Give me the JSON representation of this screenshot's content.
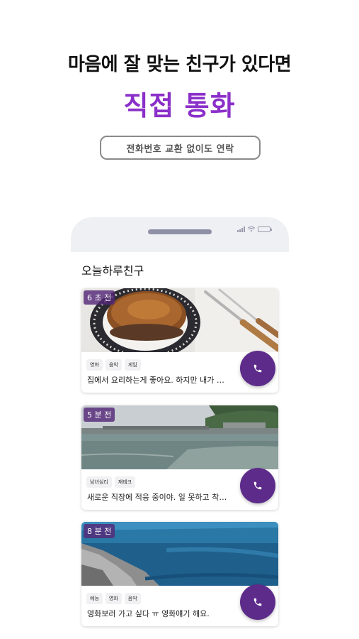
{
  "promo": {
    "headline": "마음에 잘 맞는 친구가 있다면",
    "title": "직접 통화",
    "pill": "전화번호 교환 없이도 연락",
    "accent_color": "#8b2fc9"
  },
  "phone": {
    "section_title": "오늘하루친구",
    "cards": [
      {
        "time": "6 초 전",
        "tags": [
          "영화",
          "음악",
          "게임"
        ],
        "message": "집에서 요리하는게 좋아요. 하지만 내가 …",
        "image": "bagel-on-plate-photo",
        "action_icon": "phone-icon"
      },
      {
        "time": "5 분 전",
        "tags": [
          "남녀심리",
          "재테크"
        ],
        "message": "새로운 직장에 적응 중이야. 일 못하고 착…",
        "image": "harbor-sea-photo",
        "action_icon": "phone-icon"
      },
      {
        "time": "8 분 전",
        "tags": [
          "예능",
          "영화",
          "음악"
        ],
        "message": "영화보러 가고 싶다 ㅠ 영화얘기 해요.",
        "image": "rocky-coast-sea-photo",
        "action_icon": "phone-icon"
      }
    ],
    "call_button_color": "#5d2b8a"
  }
}
